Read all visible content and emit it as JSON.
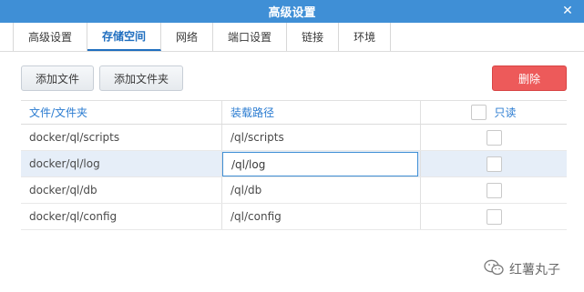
{
  "window": {
    "title": "高级设置",
    "close_glyph": "✕"
  },
  "tabs": [
    {
      "label": "高级设置",
      "active": false
    },
    {
      "label": "存储空间",
      "active": true
    },
    {
      "label": "网络",
      "active": false
    },
    {
      "label": "端口设置",
      "active": false
    },
    {
      "label": "链接",
      "active": false
    },
    {
      "label": "环境",
      "active": false
    }
  ],
  "toolbar": {
    "add_file_label": "添加文件",
    "add_folder_label": "添加文件夹",
    "delete_label": "删除"
  },
  "table": {
    "headers": {
      "folder": "文件/文件夹",
      "mount": "装载路径",
      "readonly": "只读"
    },
    "rows": [
      {
        "folder": "docker/ql/scripts",
        "mount": "/ql/scripts",
        "readonly": false
      },
      {
        "folder": "docker/ql/log",
        "mount": "/ql/log",
        "readonly": false,
        "selected": true
      },
      {
        "folder": "docker/ql/db",
        "mount": "/ql/db",
        "readonly": false
      },
      {
        "folder": "docker/ql/config",
        "mount": "/ql/config",
        "readonly": false
      }
    ]
  },
  "watermark": {
    "text": "红薯丸子",
    "icon": "wechat-icon"
  },
  "colors": {
    "accent": "#3f8fd6",
    "danger": "#ed5a5a",
    "header_text": "#2b7cd1"
  }
}
